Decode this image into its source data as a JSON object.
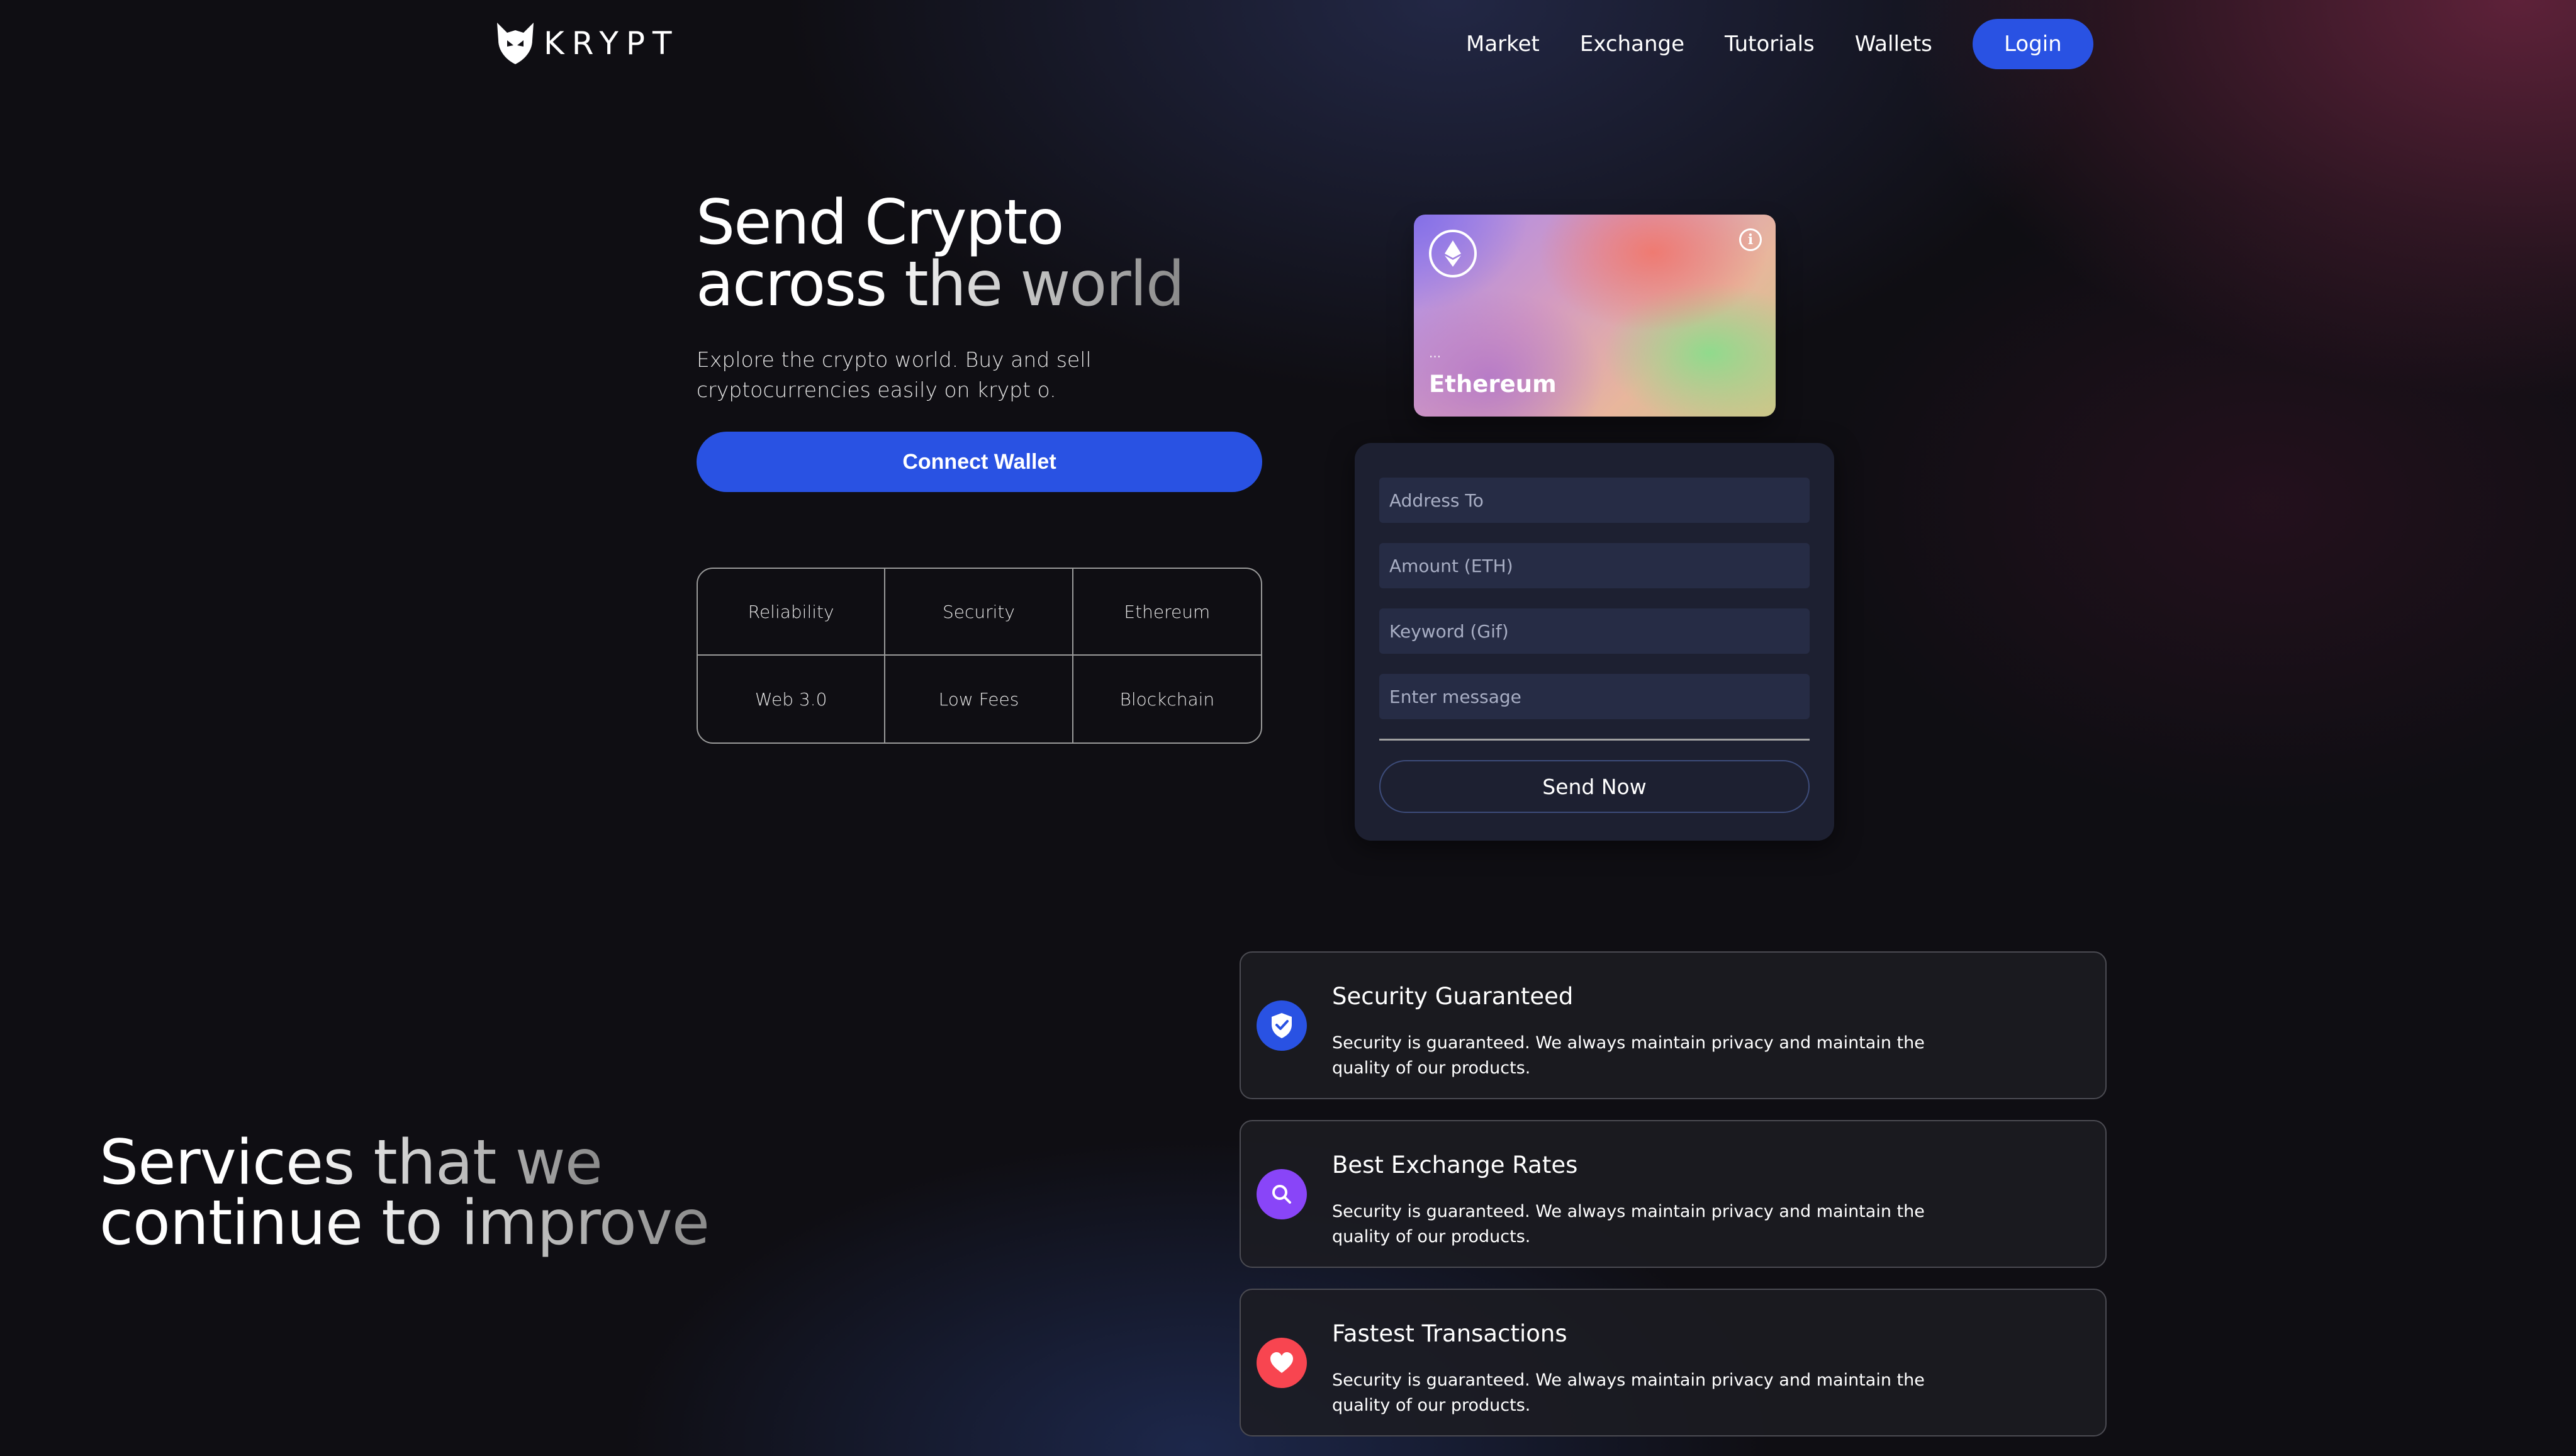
{
  "brand": {
    "name": "KRYPT",
    "logo_icon": "krypt-fox-logo"
  },
  "nav": {
    "links": [
      "Market",
      "Exchange",
      "Tutorials",
      "Wallets"
    ],
    "login_label": "Login"
  },
  "hero": {
    "title_line1": "Send Crypto",
    "title_line2_plain": "across the ",
    "title_line2_fade": "world",
    "subtitle": "Explore the crypto world. Buy and sell cryptocurrencies easily on krypt o.",
    "connect_label": "Connect Wallet",
    "features": [
      "Reliability",
      "Security",
      "Ethereum",
      "Web 3.0",
      "Low Fees",
      "Blockchain"
    ]
  },
  "card": {
    "icon": "ethereum-icon",
    "info_icon": "info-icon",
    "address": "...",
    "label": "Ethereum",
    "colors": {
      "purple": "#a78bf0",
      "coral": "#f0786e",
      "green": "#8cdc8c"
    }
  },
  "form": {
    "address_placeholder": "Address To",
    "amount_placeholder": "Amount (ETH)",
    "keyword_placeholder": "Keyword (Gif)",
    "message_placeholder": "Enter message",
    "send_label": "Send Now"
  },
  "services": {
    "title_line1_plain": "Services that ",
    "title_line1_fade": "we",
    "title_line2_plain": "continue to ",
    "title_line2_fade": "improve",
    "cards": [
      {
        "title": "Security Guaranteed",
        "description": "Security is guaranteed. We always maintain privacy and maintain the quality of our products.",
        "icon": "shield-check-icon",
        "color": "#2952e3"
      },
      {
        "title": "Best Exchange Rates",
        "description": "Security is guaranteed. We always maintain privacy and maintain the quality of our products.",
        "icon": "search-icon",
        "color": "#8945f8"
      },
      {
        "title": "Fastest Transactions",
        "description": "Security is guaranteed. We always maintain privacy and maintain the quality of our products.",
        "icon": "heart-icon",
        "color": "#f84550"
      }
    ]
  },
  "colors": {
    "accent": "#2952e3",
    "background": "#0f0e13",
    "form_bg": "#1e2234",
    "input_bg": "#262c45"
  }
}
